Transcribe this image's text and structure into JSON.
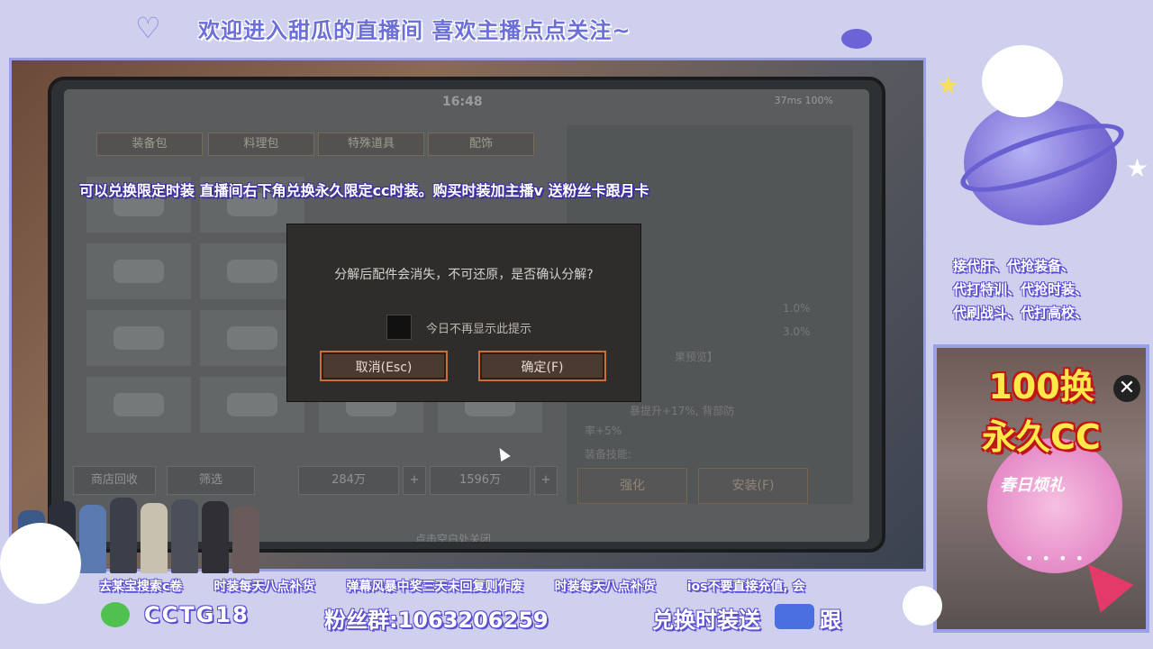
{
  "banner": {
    "text": "欢迎进入甜瓜的直播间 喜欢主播点点关注~"
  },
  "notice": "可以兑换限定时装 直播间右下角兑换永久限定cc时装。购买时装加主播v  送粉丝卡跟月卡",
  "game": {
    "clock": "16:48",
    "status_right": "37ms 100%",
    "tabs": [
      "装备包",
      "料理包",
      "特殊道具",
      "配饰"
    ],
    "right_panel_lines": [
      "1.0%",
      "3.0%",
      "果预览】",
      "暴提升+17%, 背部防",
      "率+5%",
      "装备技能:"
    ],
    "right_buttons": [
      "强化",
      "安装(F)"
    ],
    "bottom_bar": {
      "left_btn": "商店回收",
      "filter_btn": "筛选",
      "currency1": "284万",
      "currency2": "1596万"
    },
    "close_hint": "点击空白处关闭"
  },
  "dialog": {
    "message": "分解后配件会消失，不可还原，是否确认分解?",
    "dont_show_label": "今日不再显示此提示",
    "cancel_label": "取消(Esc)",
    "confirm_label": "确定(F)"
  },
  "services": [
    "接代肝、代抢装备、",
    "代打特训、代抢时装、",
    "代刷战斗、代打高校、"
  ],
  "promo": {
    "line1": "100换",
    "line2": "永久CC",
    "badge": "春日烦礼",
    "close": "✕",
    "dots": "• • • •"
  },
  "ticker": [
    "去某宝搜索c卷",
    "时装每天八点补货",
    "弹幕风暴中奖三天未回复则作废",
    "时装每天八点补货",
    "ios不要直接充值, 会"
  ],
  "footer": {
    "wechat_id": "CCTG18",
    "fan_group": "粉丝群:1063206259",
    "exchange": "兑换时装送",
    "follow": "跟"
  },
  "colors": {
    "accent": "#6b6fd6",
    "dialog_btn_border": "#c4713f",
    "promo_text": "#ffe94a"
  }
}
